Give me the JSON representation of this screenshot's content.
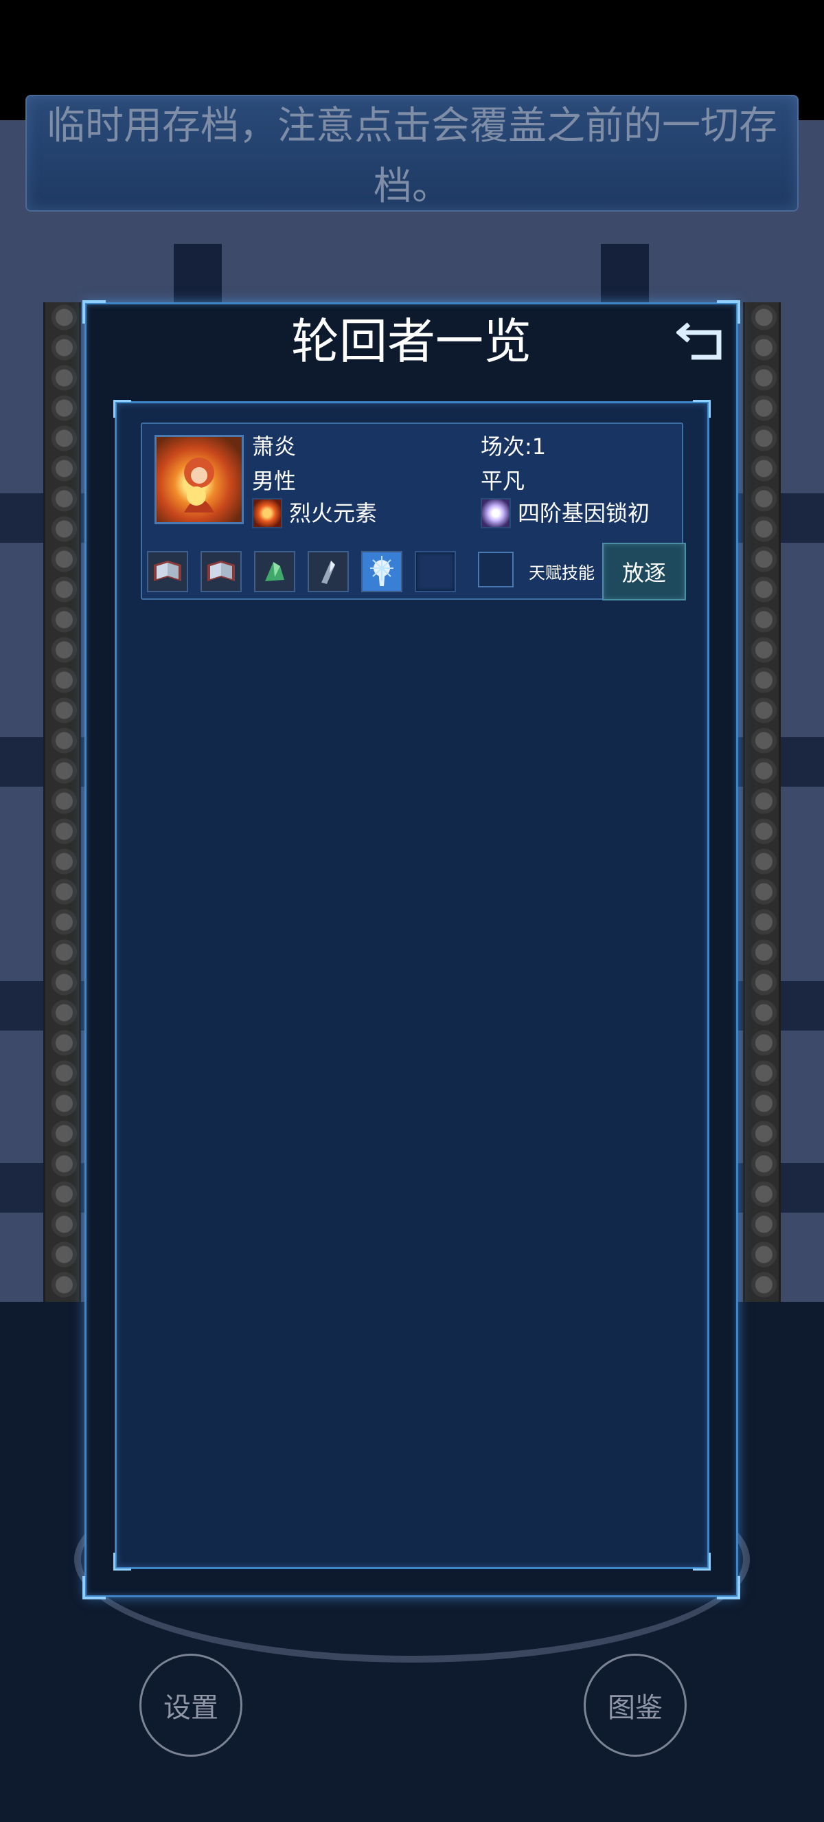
{
  "banner": {
    "notice": "临时用存档，注意点击会覆盖之前的一切存档。"
  },
  "panel": {
    "title": "轮回者一览",
    "back_icon": "back-arrow-icon"
  },
  "character": {
    "name": "萧炎",
    "gender": "男性",
    "element_icon": "fire-element-icon",
    "element": "烈火元素",
    "round": "场次:1",
    "rank": "平凡",
    "gene_icon": "gene-lock-icon",
    "gene_lock": "四阶基因锁初",
    "item_slots": [
      {
        "icon": "skill-book-icon"
      },
      {
        "icon": "skill-book-icon"
      },
      {
        "icon": "green-crystal-icon"
      },
      {
        "icon": "silver-crystal-icon"
      },
      {
        "icon": "light-pillar-icon"
      },
      {
        "icon": "empty-slot-icon"
      }
    ],
    "talent_label": "天赋技能",
    "exile_label": "放逐"
  },
  "background_buttons": {
    "settings": "设置",
    "codex": "图鉴"
  },
  "colors": {
    "panel_border": "#3f86c8",
    "panel_bg": "#0d1a2e",
    "inner_bg": "#12284a",
    "card_bg": "#173463",
    "exile_bg": "#1f4a5e",
    "banner_text": "#7f8ea6"
  }
}
